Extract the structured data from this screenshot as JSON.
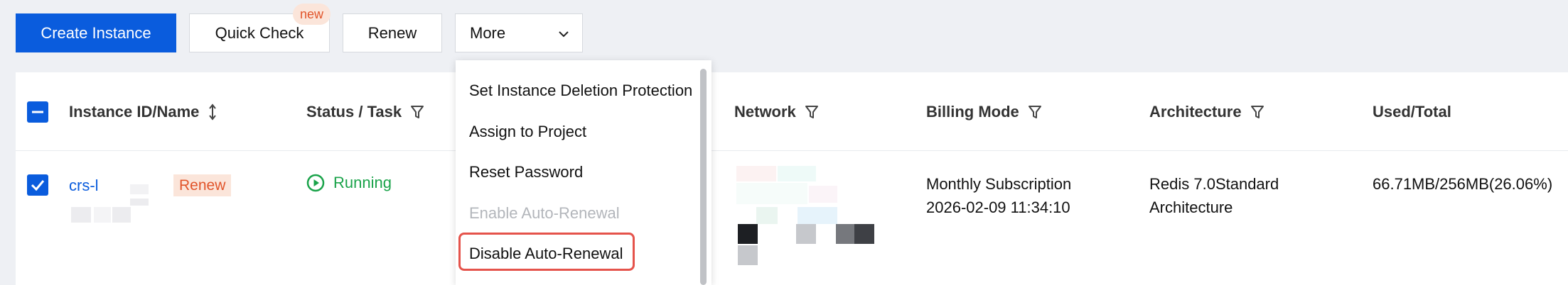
{
  "toolbar": {
    "create_label": "Create Instance",
    "quick_check_label": "Quick Check",
    "new_badge": "new",
    "renew_label": "Renew",
    "more_label": "More"
  },
  "columns": {
    "instance": "Instance ID/Name",
    "status": "Status / Task",
    "network": "Network",
    "billing": "Billing Mode",
    "architecture": "Architecture",
    "used": "Used/Total"
  },
  "row": {
    "instance_id": "crs-l",
    "renew_tag": "Renew",
    "status": "Running",
    "billing_mode": "Monthly Subscription",
    "billing_date": "2026-02-09 11:34:10",
    "arch_line1": "Redis 7.0Standard",
    "arch_line2": "Architecture",
    "used": "66.71MB/256MB(26.06%)"
  },
  "more_menu": {
    "items": [
      {
        "label": "Set Instance Deletion Protection",
        "disabled": false
      },
      {
        "label": "Assign to Project",
        "disabled": false
      },
      {
        "label": "Reset Password",
        "disabled": false
      },
      {
        "label": "Enable Auto-Renewal",
        "disabled": true
      },
      {
        "label": "Disable Auto-Renewal",
        "disabled": false,
        "highlighted": true
      }
    ]
  },
  "colors": {
    "primary": "#0a5cdd",
    "running": "#1aa34a",
    "renew_tag_bg": "#fbe5da",
    "renew_tag_text": "#e1542a",
    "highlight_border": "#e5534b"
  },
  "icons": {
    "sort": "sort-arrows-icon",
    "filter": "filter-funnel-icon",
    "chevron": "chevron-down-icon",
    "running": "play-circle-icon",
    "checkbox_checked": "checkmark-icon",
    "checkbox_indeterminate": "minus-icon"
  }
}
